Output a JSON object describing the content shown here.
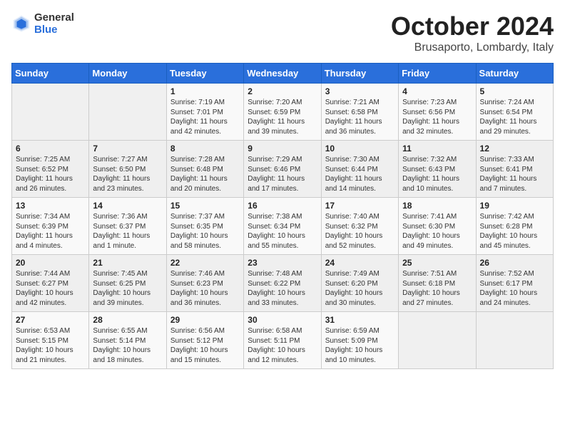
{
  "header": {
    "logo_general": "General",
    "logo_blue": "Blue",
    "month_title": "October 2024",
    "location": "Brusaporto, Lombardy, Italy"
  },
  "days_of_week": [
    "Sunday",
    "Monday",
    "Tuesday",
    "Wednesday",
    "Thursday",
    "Friday",
    "Saturday"
  ],
  "weeks": [
    [
      {
        "day": "",
        "sunrise": "",
        "sunset": "",
        "daylight": ""
      },
      {
        "day": "",
        "sunrise": "",
        "sunset": "",
        "daylight": ""
      },
      {
        "day": "1",
        "sunrise": "Sunrise: 7:19 AM",
        "sunset": "Sunset: 7:01 PM",
        "daylight": "Daylight: 11 hours and 42 minutes."
      },
      {
        "day": "2",
        "sunrise": "Sunrise: 7:20 AM",
        "sunset": "Sunset: 6:59 PM",
        "daylight": "Daylight: 11 hours and 39 minutes."
      },
      {
        "day": "3",
        "sunrise": "Sunrise: 7:21 AM",
        "sunset": "Sunset: 6:58 PM",
        "daylight": "Daylight: 11 hours and 36 minutes."
      },
      {
        "day": "4",
        "sunrise": "Sunrise: 7:23 AM",
        "sunset": "Sunset: 6:56 PM",
        "daylight": "Daylight: 11 hours and 32 minutes."
      },
      {
        "day": "5",
        "sunrise": "Sunrise: 7:24 AM",
        "sunset": "Sunset: 6:54 PM",
        "daylight": "Daylight: 11 hours and 29 minutes."
      }
    ],
    [
      {
        "day": "6",
        "sunrise": "Sunrise: 7:25 AM",
        "sunset": "Sunset: 6:52 PM",
        "daylight": "Daylight: 11 hours and 26 minutes."
      },
      {
        "day": "7",
        "sunrise": "Sunrise: 7:27 AM",
        "sunset": "Sunset: 6:50 PM",
        "daylight": "Daylight: 11 hours and 23 minutes."
      },
      {
        "day": "8",
        "sunrise": "Sunrise: 7:28 AM",
        "sunset": "Sunset: 6:48 PM",
        "daylight": "Daylight: 11 hours and 20 minutes."
      },
      {
        "day": "9",
        "sunrise": "Sunrise: 7:29 AM",
        "sunset": "Sunset: 6:46 PM",
        "daylight": "Daylight: 11 hours and 17 minutes."
      },
      {
        "day": "10",
        "sunrise": "Sunrise: 7:30 AM",
        "sunset": "Sunset: 6:44 PM",
        "daylight": "Daylight: 11 hours and 14 minutes."
      },
      {
        "day": "11",
        "sunrise": "Sunrise: 7:32 AM",
        "sunset": "Sunset: 6:43 PM",
        "daylight": "Daylight: 11 hours and 10 minutes."
      },
      {
        "day": "12",
        "sunrise": "Sunrise: 7:33 AM",
        "sunset": "Sunset: 6:41 PM",
        "daylight": "Daylight: 11 hours and 7 minutes."
      }
    ],
    [
      {
        "day": "13",
        "sunrise": "Sunrise: 7:34 AM",
        "sunset": "Sunset: 6:39 PM",
        "daylight": "Daylight: 11 hours and 4 minutes."
      },
      {
        "day": "14",
        "sunrise": "Sunrise: 7:36 AM",
        "sunset": "Sunset: 6:37 PM",
        "daylight": "Daylight: 11 hours and 1 minute."
      },
      {
        "day": "15",
        "sunrise": "Sunrise: 7:37 AM",
        "sunset": "Sunset: 6:35 PM",
        "daylight": "Daylight: 10 hours and 58 minutes."
      },
      {
        "day": "16",
        "sunrise": "Sunrise: 7:38 AM",
        "sunset": "Sunset: 6:34 PM",
        "daylight": "Daylight: 10 hours and 55 minutes."
      },
      {
        "day": "17",
        "sunrise": "Sunrise: 7:40 AM",
        "sunset": "Sunset: 6:32 PM",
        "daylight": "Daylight: 10 hours and 52 minutes."
      },
      {
        "day": "18",
        "sunrise": "Sunrise: 7:41 AM",
        "sunset": "Sunset: 6:30 PM",
        "daylight": "Daylight: 10 hours and 49 minutes."
      },
      {
        "day": "19",
        "sunrise": "Sunrise: 7:42 AM",
        "sunset": "Sunset: 6:28 PM",
        "daylight": "Daylight: 10 hours and 45 minutes."
      }
    ],
    [
      {
        "day": "20",
        "sunrise": "Sunrise: 7:44 AM",
        "sunset": "Sunset: 6:27 PM",
        "daylight": "Daylight: 10 hours and 42 minutes."
      },
      {
        "day": "21",
        "sunrise": "Sunrise: 7:45 AM",
        "sunset": "Sunset: 6:25 PM",
        "daylight": "Daylight: 10 hours and 39 minutes."
      },
      {
        "day": "22",
        "sunrise": "Sunrise: 7:46 AM",
        "sunset": "Sunset: 6:23 PM",
        "daylight": "Daylight: 10 hours and 36 minutes."
      },
      {
        "day": "23",
        "sunrise": "Sunrise: 7:48 AM",
        "sunset": "Sunset: 6:22 PM",
        "daylight": "Daylight: 10 hours and 33 minutes."
      },
      {
        "day": "24",
        "sunrise": "Sunrise: 7:49 AM",
        "sunset": "Sunset: 6:20 PM",
        "daylight": "Daylight: 10 hours and 30 minutes."
      },
      {
        "day": "25",
        "sunrise": "Sunrise: 7:51 AM",
        "sunset": "Sunset: 6:18 PM",
        "daylight": "Daylight: 10 hours and 27 minutes."
      },
      {
        "day": "26",
        "sunrise": "Sunrise: 7:52 AM",
        "sunset": "Sunset: 6:17 PM",
        "daylight": "Daylight: 10 hours and 24 minutes."
      }
    ],
    [
      {
        "day": "27",
        "sunrise": "Sunrise: 6:53 AM",
        "sunset": "Sunset: 5:15 PM",
        "daylight": "Daylight: 10 hours and 21 minutes."
      },
      {
        "day": "28",
        "sunrise": "Sunrise: 6:55 AM",
        "sunset": "Sunset: 5:14 PM",
        "daylight": "Daylight: 10 hours and 18 minutes."
      },
      {
        "day": "29",
        "sunrise": "Sunrise: 6:56 AM",
        "sunset": "Sunset: 5:12 PM",
        "daylight": "Daylight: 10 hours and 15 minutes."
      },
      {
        "day": "30",
        "sunrise": "Sunrise: 6:58 AM",
        "sunset": "Sunset: 5:11 PM",
        "daylight": "Daylight: 10 hours and 12 minutes."
      },
      {
        "day": "31",
        "sunrise": "Sunrise: 6:59 AM",
        "sunset": "Sunset: 5:09 PM",
        "daylight": "Daylight: 10 hours and 10 minutes."
      },
      {
        "day": "",
        "sunrise": "",
        "sunset": "",
        "daylight": ""
      },
      {
        "day": "",
        "sunrise": "",
        "sunset": "",
        "daylight": ""
      }
    ]
  ]
}
